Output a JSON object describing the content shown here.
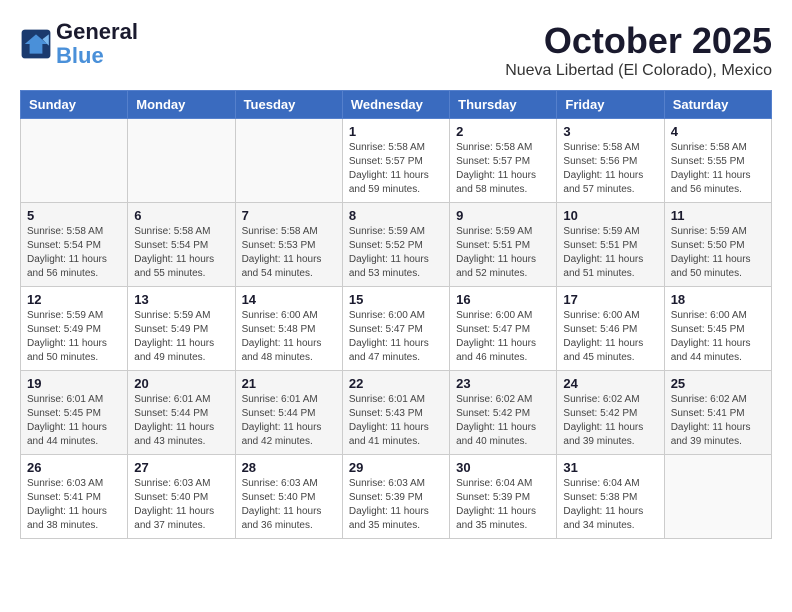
{
  "logo": {
    "line1": "General",
    "line2": "Blue"
  },
  "title": "October 2025",
  "subtitle": "Nueva Libertad (El Colorado), Mexico",
  "weekdays": [
    "Sunday",
    "Monday",
    "Tuesday",
    "Wednesday",
    "Thursday",
    "Friday",
    "Saturday"
  ],
  "weeks": [
    [
      {
        "day": "",
        "info": ""
      },
      {
        "day": "",
        "info": ""
      },
      {
        "day": "",
        "info": ""
      },
      {
        "day": "1",
        "info": "Sunrise: 5:58 AM\nSunset: 5:57 PM\nDaylight: 11 hours\nand 59 minutes."
      },
      {
        "day": "2",
        "info": "Sunrise: 5:58 AM\nSunset: 5:57 PM\nDaylight: 11 hours\nand 58 minutes."
      },
      {
        "day": "3",
        "info": "Sunrise: 5:58 AM\nSunset: 5:56 PM\nDaylight: 11 hours\nand 57 minutes."
      },
      {
        "day": "4",
        "info": "Sunrise: 5:58 AM\nSunset: 5:55 PM\nDaylight: 11 hours\nand 56 minutes."
      }
    ],
    [
      {
        "day": "5",
        "info": "Sunrise: 5:58 AM\nSunset: 5:54 PM\nDaylight: 11 hours\nand 56 minutes."
      },
      {
        "day": "6",
        "info": "Sunrise: 5:58 AM\nSunset: 5:54 PM\nDaylight: 11 hours\nand 55 minutes."
      },
      {
        "day": "7",
        "info": "Sunrise: 5:58 AM\nSunset: 5:53 PM\nDaylight: 11 hours\nand 54 minutes."
      },
      {
        "day": "8",
        "info": "Sunrise: 5:59 AM\nSunset: 5:52 PM\nDaylight: 11 hours\nand 53 minutes."
      },
      {
        "day": "9",
        "info": "Sunrise: 5:59 AM\nSunset: 5:51 PM\nDaylight: 11 hours\nand 52 minutes."
      },
      {
        "day": "10",
        "info": "Sunrise: 5:59 AM\nSunset: 5:51 PM\nDaylight: 11 hours\nand 51 minutes."
      },
      {
        "day": "11",
        "info": "Sunrise: 5:59 AM\nSunset: 5:50 PM\nDaylight: 11 hours\nand 50 minutes."
      }
    ],
    [
      {
        "day": "12",
        "info": "Sunrise: 5:59 AM\nSunset: 5:49 PM\nDaylight: 11 hours\nand 50 minutes."
      },
      {
        "day": "13",
        "info": "Sunrise: 5:59 AM\nSunset: 5:49 PM\nDaylight: 11 hours\nand 49 minutes."
      },
      {
        "day": "14",
        "info": "Sunrise: 6:00 AM\nSunset: 5:48 PM\nDaylight: 11 hours\nand 48 minutes."
      },
      {
        "day": "15",
        "info": "Sunrise: 6:00 AM\nSunset: 5:47 PM\nDaylight: 11 hours\nand 47 minutes."
      },
      {
        "day": "16",
        "info": "Sunrise: 6:00 AM\nSunset: 5:47 PM\nDaylight: 11 hours\nand 46 minutes."
      },
      {
        "day": "17",
        "info": "Sunrise: 6:00 AM\nSunset: 5:46 PM\nDaylight: 11 hours\nand 45 minutes."
      },
      {
        "day": "18",
        "info": "Sunrise: 6:00 AM\nSunset: 5:45 PM\nDaylight: 11 hours\nand 44 minutes."
      }
    ],
    [
      {
        "day": "19",
        "info": "Sunrise: 6:01 AM\nSunset: 5:45 PM\nDaylight: 11 hours\nand 44 minutes."
      },
      {
        "day": "20",
        "info": "Sunrise: 6:01 AM\nSunset: 5:44 PM\nDaylight: 11 hours\nand 43 minutes."
      },
      {
        "day": "21",
        "info": "Sunrise: 6:01 AM\nSunset: 5:44 PM\nDaylight: 11 hours\nand 42 minutes."
      },
      {
        "day": "22",
        "info": "Sunrise: 6:01 AM\nSunset: 5:43 PM\nDaylight: 11 hours\nand 41 minutes."
      },
      {
        "day": "23",
        "info": "Sunrise: 6:02 AM\nSunset: 5:42 PM\nDaylight: 11 hours\nand 40 minutes."
      },
      {
        "day": "24",
        "info": "Sunrise: 6:02 AM\nSunset: 5:42 PM\nDaylight: 11 hours\nand 39 minutes."
      },
      {
        "day": "25",
        "info": "Sunrise: 6:02 AM\nSunset: 5:41 PM\nDaylight: 11 hours\nand 39 minutes."
      }
    ],
    [
      {
        "day": "26",
        "info": "Sunrise: 6:03 AM\nSunset: 5:41 PM\nDaylight: 11 hours\nand 38 minutes."
      },
      {
        "day": "27",
        "info": "Sunrise: 6:03 AM\nSunset: 5:40 PM\nDaylight: 11 hours\nand 37 minutes."
      },
      {
        "day": "28",
        "info": "Sunrise: 6:03 AM\nSunset: 5:40 PM\nDaylight: 11 hours\nand 36 minutes."
      },
      {
        "day": "29",
        "info": "Sunrise: 6:03 AM\nSunset: 5:39 PM\nDaylight: 11 hours\nand 35 minutes."
      },
      {
        "day": "30",
        "info": "Sunrise: 6:04 AM\nSunset: 5:39 PM\nDaylight: 11 hours\nand 35 minutes."
      },
      {
        "day": "31",
        "info": "Sunrise: 6:04 AM\nSunset: 5:38 PM\nDaylight: 11 hours\nand 34 minutes."
      },
      {
        "day": "",
        "info": ""
      }
    ]
  ]
}
